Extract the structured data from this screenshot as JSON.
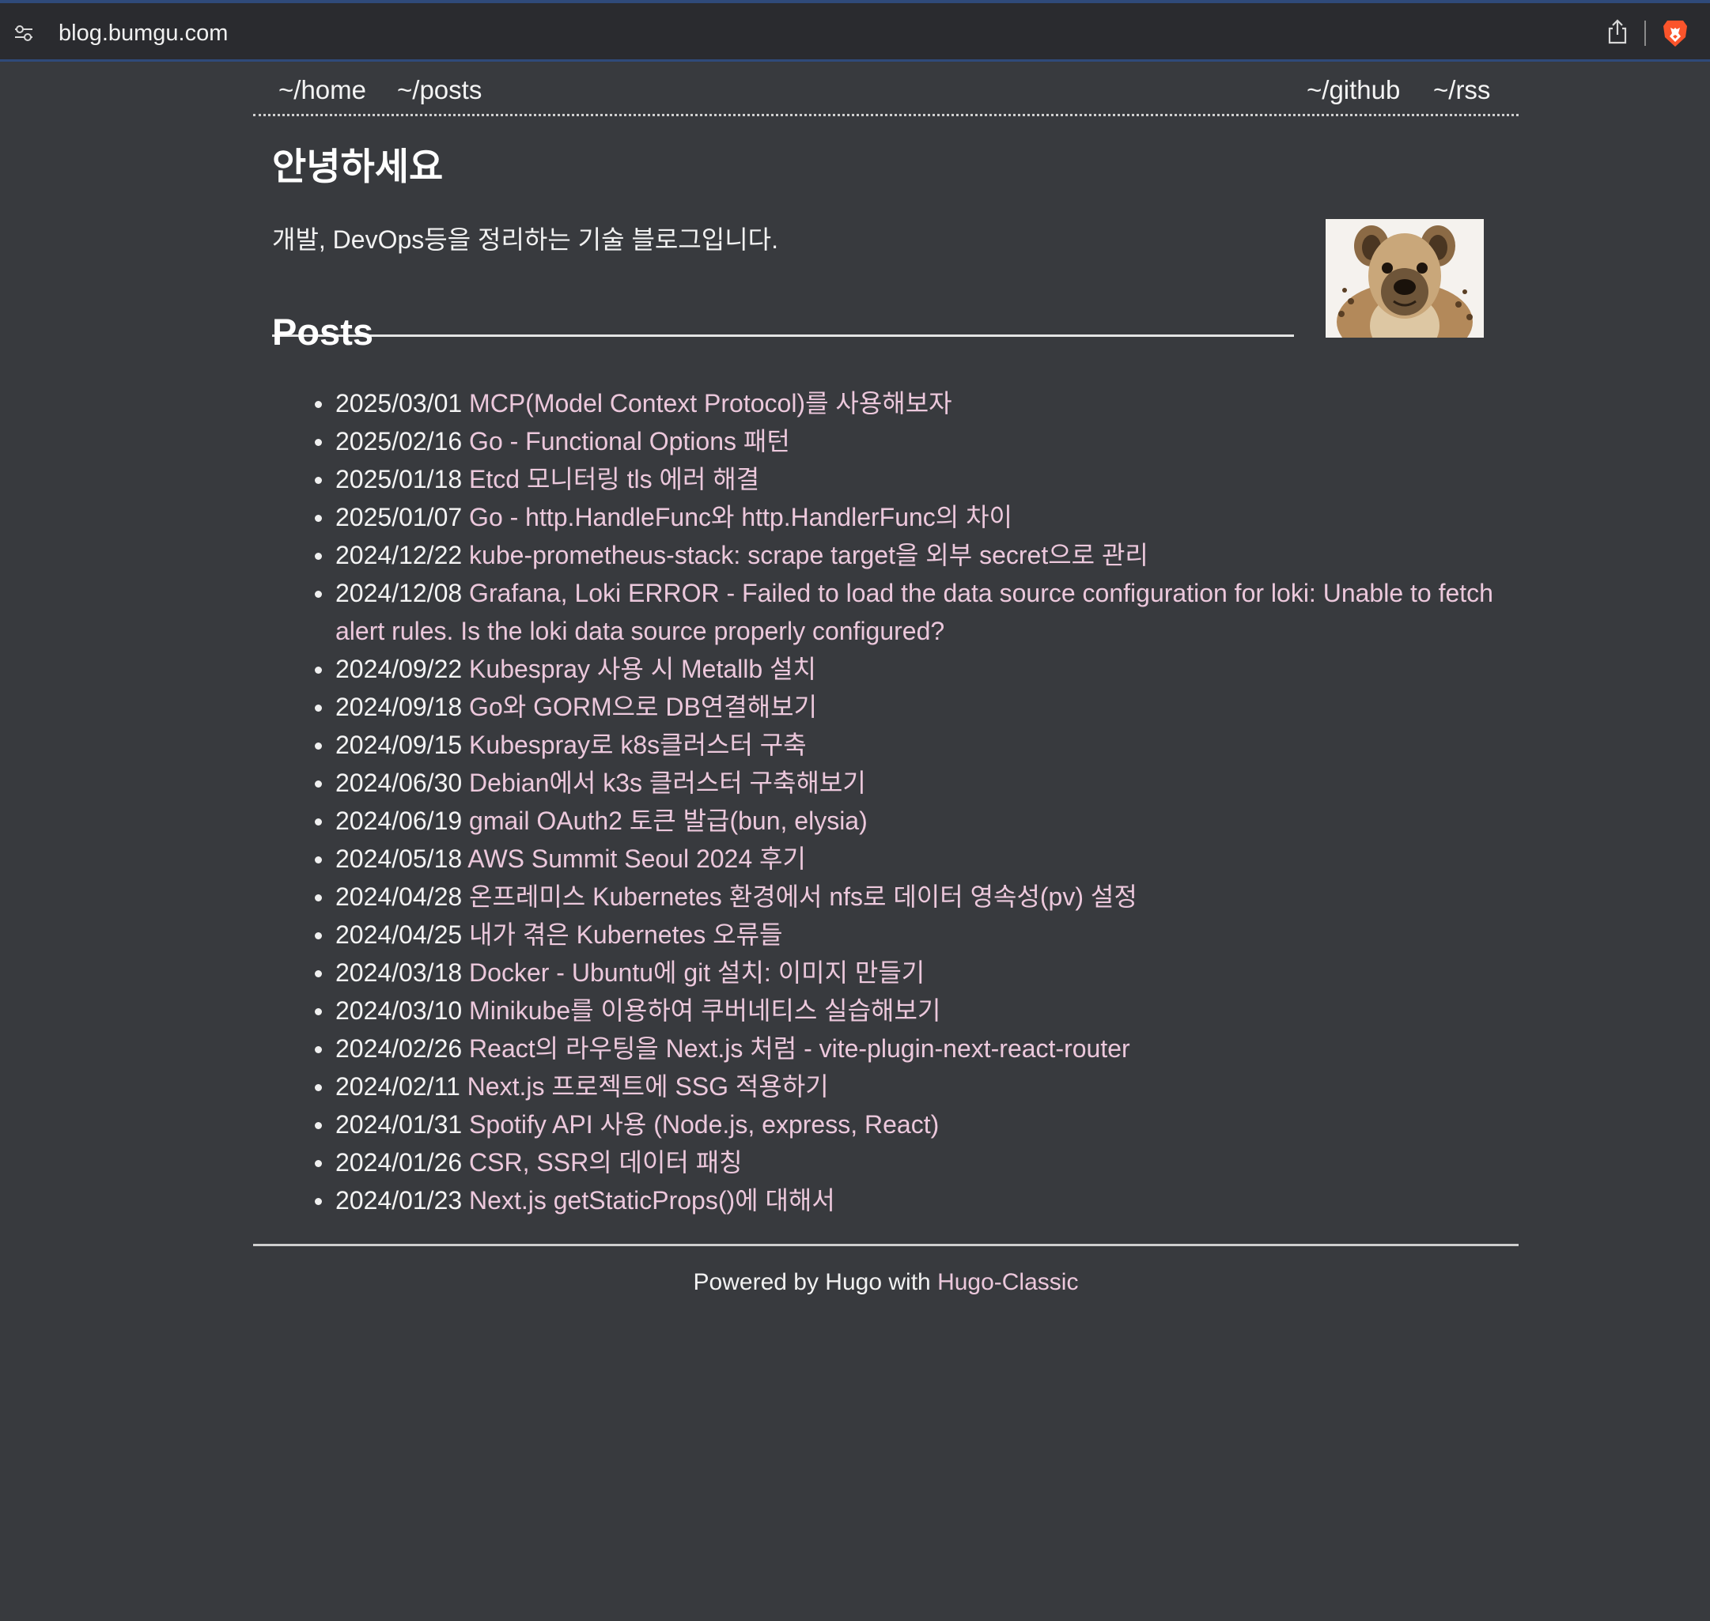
{
  "browser": {
    "url": "blog.bumgu.com",
    "icons": [
      "site-settings-icon",
      "share-icon",
      "brave-lion-icon"
    ]
  },
  "nav": {
    "home": "~/home",
    "posts": "~/posts",
    "github": "~/github",
    "rss": "~/rss"
  },
  "intro": {
    "title": "안녕하세요",
    "description": "개발, DevOps등을 정리하는 기술 블로그입니다."
  },
  "posts": {
    "heading": "Posts",
    "items": [
      {
        "date": "2025/03/01",
        "title": "MCP(Model Context Protocol)를 사용해보자"
      },
      {
        "date": "2025/02/16",
        "title": "Go - Functional Options 패턴"
      },
      {
        "date": "2025/01/18",
        "title": "Etcd 모니터링 tls 에러 해결"
      },
      {
        "date": "2025/01/07",
        "title": "Go - http.HandleFunc와 http.HandlerFunc의 차이"
      },
      {
        "date": "2024/12/22",
        "title": "kube-prometheus-stack: scrape target을 외부 secret으로 관리"
      },
      {
        "date": "2024/12/08",
        "title": "Grafana, Loki ERROR - Failed to load the data source configuration for loki: Unable to fetch alert rules. Is the loki data source properly configured?"
      },
      {
        "date": "2024/09/22",
        "title": "Kubespray 사용 시 Metallb 설치"
      },
      {
        "date": "2024/09/18",
        "title": "Go와 GORM으로 DB연결해보기"
      },
      {
        "date": "2024/09/15",
        "title": "Kubespray로 k8s클러스터 구축"
      },
      {
        "date": "2024/06/30",
        "title": "Debian에서 k3s 클러스터 구축해보기"
      },
      {
        "date": "2024/06/19",
        "title": "gmail OAuth2 토큰 발급(bun, elysia)"
      },
      {
        "date": "2024/05/18",
        "title": "AWS Summit Seoul 2024 후기"
      },
      {
        "date": "2024/04/28",
        "title": "온프레미스 Kubernetes 환경에서 nfs로 데이터 영속성(pv) 설정"
      },
      {
        "date": "2024/04/25",
        "title": "내가 겪은 Kubernetes 오류들"
      },
      {
        "date": "2024/03/18",
        "title": "Docker - Ubuntu에 git 설치: 이미지 만들기"
      },
      {
        "date": "2024/03/10",
        "title": "Minikube를 이용하여 쿠버네티스 실습해보기"
      },
      {
        "date": "2024/02/26",
        "title": "React의 라우팅을 Next.js 처럼 - vite-plugin-next-react-router"
      },
      {
        "date": "2024/02/11",
        "title": "Next.js 프로젝트에 SSG 적용하기"
      },
      {
        "date": "2024/01/31",
        "title": "Spotify API 사용 (Node.js, express, React)"
      },
      {
        "date": "2024/01/26",
        "title": "CSR, SSR의 데이터 패칭"
      },
      {
        "date": "2024/01/23",
        "title": "Next.js getStaticProps()에 대해서"
      }
    ]
  },
  "footer": {
    "prefix": "Powered by Hugo with",
    "link": "Hugo-Classic"
  },
  "colors": {
    "background": "#383a3e",
    "link": "#ecc8dc",
    "text": "#f4f4f4"
  }
}
